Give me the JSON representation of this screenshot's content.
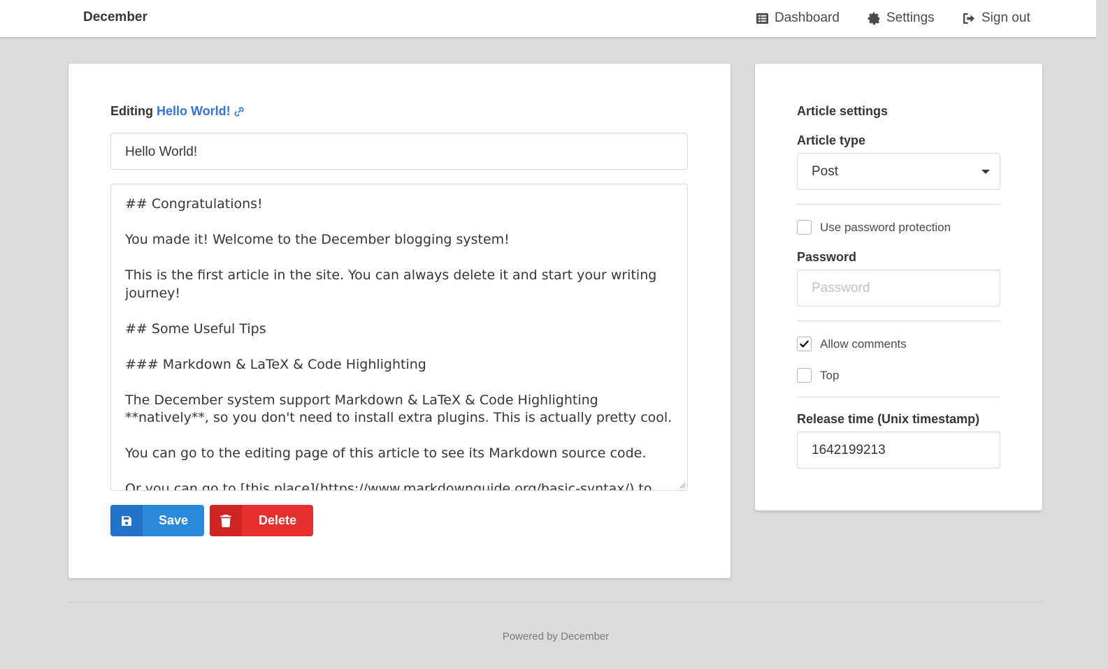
{
  "navbar": {
    "brand": "December",
    "items": [
      {
        "label": "Dashboard",
        "icon": "list-icon"
      },
      {
        "label": "Settings",
        "icon": "gear-icon"
      },
      {
        "label": "Sign out",
        "icon": "sign-out-icon"
      }
    ]
  },
  "editor": {
    "editing_prefix": "Editing",
    "article_title_link": "Hello World!",
    "title_value": "Hello World!",
    "content_lines": [
      "## Congratulations!",
      "",
      "You made it! Welcome to the December blogging system!",
      "",
      "This is the first article in the site. You can always delete it and start your writing",
      "journey!",
      "",
      "## Some Useful Tips",
      "",
      "### Markdown & LaTeX & Code Highlighting",
      "",
      "The December system support Markdown & LaTeX & Code Highlighting",
      "**natively**, so you don't need to install extra plugins. This is actually pretty cool.",
      "",
      "You can go to the editing page of this article to see its Markdown source code.",
      "",
      "Or you can go to [this place](https://www.markdownguide.org/basic-syntax/) to"
    ],
    "save_label": "Save",
    "delete_label": "Delete"
  },
  "settings": {
    "heading": "Article settings",
    "article_type_label": "Article type",
    "article_type_value": "Post",
    "use_password_label": "Use password protection",
    "use_password_checked": false,
    "password_label": "Password",
    "password_placeholder": "Password",
    "allow_comments_label": "Allow comments",
    "allow_comments_checked": true,
    "top_label": "Top",
    "top_checked": false,
    "release_time_label": "Release time (Unix timestamp)",
    "release_time_value": "1642199213"
  },
  "footer": {
    "text": "Powered by December"
  },
  "colors": {
    "link": "#3273dc",
    "save": "#2b8ad9",
    "delete": "#e63030",
    "background": "#dbdbdb"
  }
}
